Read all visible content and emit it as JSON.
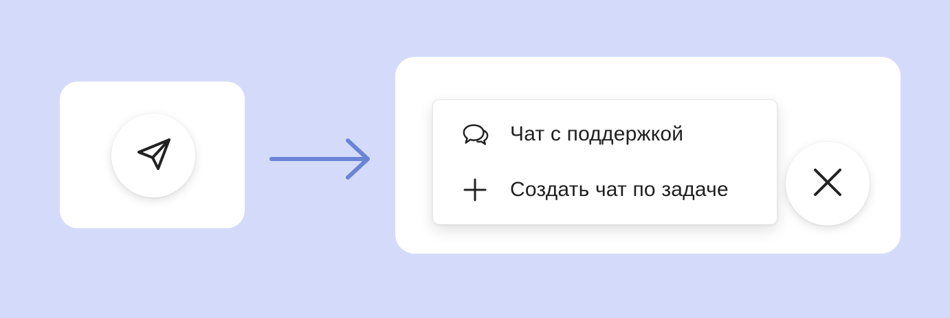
{
  "colors": {
    "background": "#d4dbfa",
    "card": "#ffffff",
    "arrow": "#6b84d6",
    "icon": "#222222",
    "text": "#1f1f1f"
  },
  "left_panel": {
    "fab_icon": "paper-plane-icon"
  },
  "transition_icon": "arrow-right-icon",
  "right_panel": {
    "menu": {
      "items": [
        {
          "icon": "chat-bubbles-icon",
          "label": "Чат с поддержкой"
        },
        {
          "icon": "plus-icon",
          "label": "Создать чат по задаче"
        }
      ]
    },
    "close_icon": "close-icon"
  }
}
